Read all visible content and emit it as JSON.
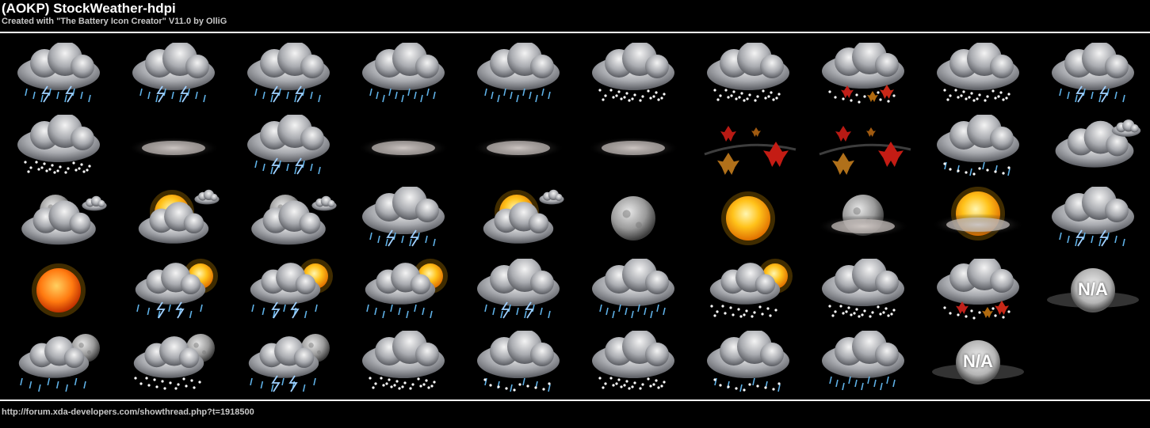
{
  "header": {
    "title": "(AOKP) StockWeather-hdpi",
    "subtitle": "Created with \"The Battery Icon Creator\" V11.0 by OlliG"
  },
  "footer": {
    "url": "http://forum.xda-developers.com/showthread.php?t=1918500"
  },
  "rows": [
    [
      "storm-rain",
      "storm-rain",
      "storm-rain",
      "rain",
      "rain",
      "snow",
      "snow",
      "leaves-rain",
      "snow",
      "storm-rain"
    ],
    [
      "snow",
      "haze",
      "storm-rain",
      "haze",
      "haze",
      "haze",
      "wind-leaves",
      "wind-leaves",
      "sleet",
      "partly-cloudy"
    ],
    [
      "moon-cloudy",
      "sun-cloudy",
      "moon-cloudy",
      "storm-rain",
      "sun-cloudy",
      "moon",
      "sun",
      "moon-haze",
      "sun-haze",
      "storm-rain"
    ],
    [
      "sun-orange",
      "sun-storm",
      "sun-storm",
      "sun-rain",
      "storm-rain",
      "rain",
      "sun-snow",
      "snow",
      "leaves-rain",
      "na"
    ],
    [
      "moon-rain",
      "moon-snow",
      "moon-storm",
      "snow",
      "sleet",
      "snow",
      "sleet",
      "rain",
      "na",
      ""
    ]
  ],
  "labels": {
    "na": "N/A"
  }
}
